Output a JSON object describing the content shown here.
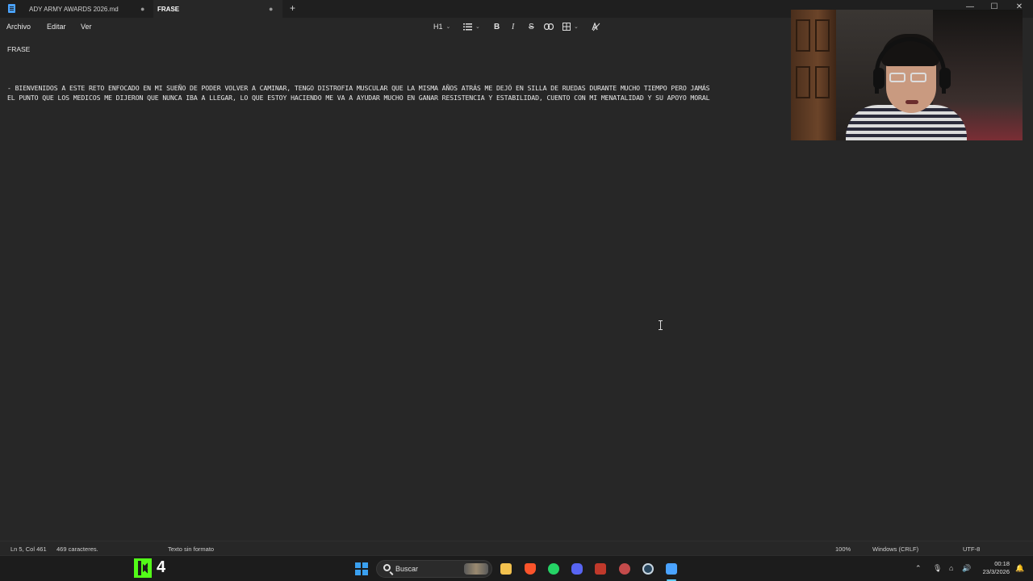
{
  "tabs": [
    {
      "label": "ADY ARMY AWARDS 2026.md",
      "modified": "●"
    },
    {
      "label": "FRASE",
      "modified": "●"
    }
  ],
  "window": {
    "minimize": "—",
    "maximize": "☐",
    "close": "✕"
  },
  "menu": {
    "file": "Archivo",
    "edit": "Editar",
    "view": "Ver"
  },
  "toolbar": {
    "heading": "H1",
    "bold": "B",
    "italic": "I",
    "strike": "S"
  },
  "document": {
    "title": "FRASE",
    "line1": "- BIENVENIDOS A ESTE RETO ENFOCADO EN MI SUEÑO DE PODER VOLVER A CAMINAR, TENGO DISTROFIA MUSCULAR QUE LA MISMA AÑOS ATRÁS ME DEJÓ EN SILLA DE RUEDAS DURANTE MUCHO TIEMPO PERO JAMÁS",
    "line2": "EL PUNTO QUE LOS MEDICOS ME DIJERON QUE NUNCA IBA A LLEGAR, LO QUE ESTOY HACIENDO ME VA A AYUDAR MUCHO EN GANAR RESISTENCIA Y ESTABILIDAD, CUENTO CON MI MENATALIDAD Y SU APOYO MORAL"
  },
  "status": {
    "position": "Ln 5, Col 461",
    "chars": "469 caracteres.",
    "format": "Texto sin formato",
    "zoom": "100%",
    "line_ending": "Windows (CRLF)",
    "encoding": "UTF-8"
  },
  "taskbar": {
    "kick_count": "4",
    "search_label": "Buscar",
    "time": "00:18",
    "date": "23/3/2026",
    "accent": "#60cdff",
    "kick_color": "#53fc18",
    "icons": [
      "file-explorer-icon",
      "brave-icon",
      "whatsapp-icon",
      "discord-icon",
      "video-editor-icon",
      "app-icon",
      "steam-icon",
      "notepad-icon"
    ]
  }
}
